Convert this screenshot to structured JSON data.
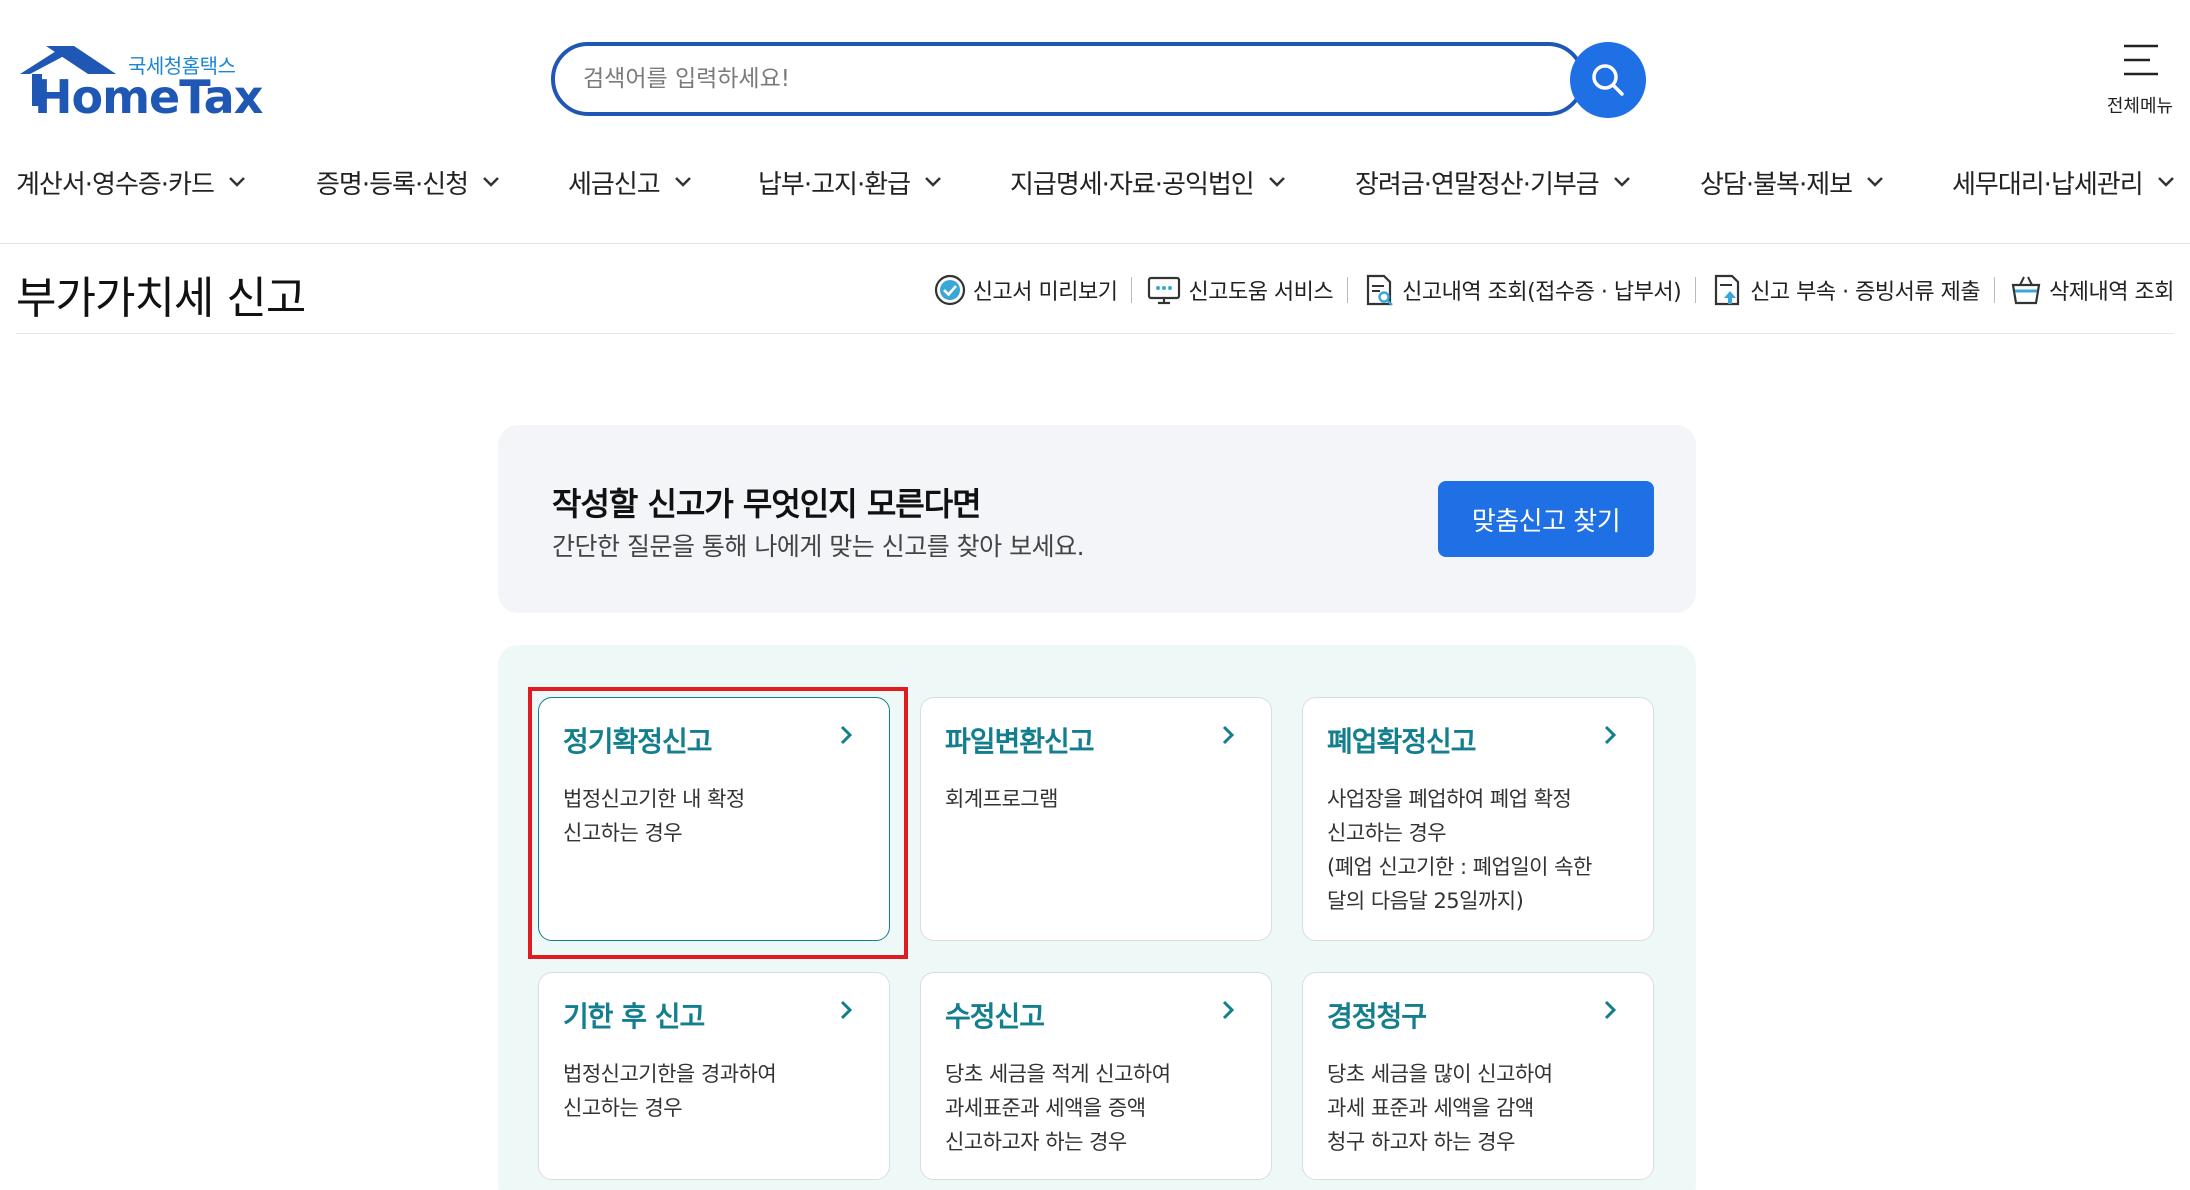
{
  "header": {
    "logo_sub": "국세청홈택스",
    "logo_main": "HomeTax",
    "search_placeholder": "검색어를 입력하세요!",
    "all_menu_label": "전체메뉴"
  },
  "gnb": {
    "items": [
      {
        "label": "계산서·영수증·카드"
      },
      {
        "label": "증명·등록·신청"
      },
      {
        "label": "세금신고"
      },
      {
        "label": "납부·고지·환급"
      },
      {
        "label": "지급명세·자료·공익법인"
      },
      {
        "label": "장려금·연말정산·기부금"
      },
      {
        "label": "상담·불복·제보"
      },
      {
        "label": "세무대리·납세관리"
      }
    ]
  },
  "page": {
    "title": "부가가치세 신고",
    "quick_links": [
      {
        "label": "신고서 미리보기",
        "icon": "check-circle-icon"
      },
      {
        "label": "신고도움 서비스",
        "icon": "monitor-help-icon"
      },
      {
        "label": "신고내역 조회(접수증 · 납부서)",
        "icon": "document-search-icon"
      },
      {
        "label": "신고 부속 · 증빙서류 제출",
        "icon": "document-upload-icon"
      },
      {
        "label": "삭제내역 조회",
        "icon": "basket-icon"
      }
    ]
  },
  "banner": {
    "title": "작성할 신고가 무엇인지 모른다면",
    "desc": "간단한 질문을 통해 나에게 맞는 신고를 찾아 보세요.",
    "button": "맞춤신고 찾기"
  },
  "cards": [
    {
      "title": "정기확정신고",
      "lines": [
        "법정신고기한 내 확정",
        "신고하는 경우"
      ]
    },
    {
      "title": "파일변환신고",
      "lines": [
        "회계프로그램"
      ]
    },
    {
      "title": "폐업확정신고",
      "lines": [
        "사업장을 폐업하여 폐업 확정",
        "신고하는 경우",
        "(폐업 신고기한 : 폐업일이 속한",
        "달의 다음달 25일까지)"
      ]
    },
    {
      "title": "기한 후 신고",
      "lines": [
        "법정신고기한을 경과하여",
        "신고하는 경우"
      ]
    },
    {
      "title": "수정신고",
      "lines": [
        "당초 세금을 적게 신고하여",
        "과세표준과 세액을 증액",
        "신고하고자 하는 경우"
      ]
    },
    {
      "title": "경정청구",
      "lines": [
        "당초 세금을 많이 신고하여",
        "과세 표준과 세액을 감액",
        "청구 하고자 하는 경우"
      ]
    }
  ],
  "colors": {
    "brand_blue": "#1f57b5",
    "button_blue": "#1f6fe5",
    "card_title_teal": "#137e8e",
    "highlight_red": "#e01b22"
  }
}
